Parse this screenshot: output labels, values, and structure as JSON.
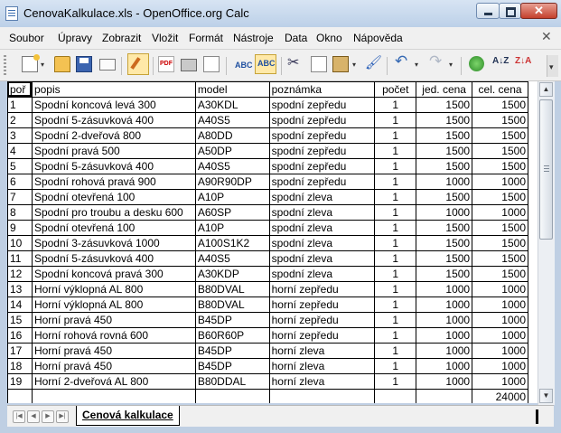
{
  "window": {
    "title": "CenovaKalkulace.xls - OpenOffice.org Calc"
  },
  "menu": [
    "Soubor",
    "Úpravy",
    "Zobrazit",
    "Vložit",
    "Formát",
    "Nástroje",
    "Data",
    "Okno",
    "Nápověda"
  ],
  "toolbar_icons": [
    "new-document-icon",
    "open-folder-icon",
    "save-disk-icon",
    "send-mail-icon",
    "edit-file-icon",
    "export-pdf-icon",
    "print-icon",
    "page-preview-icon",
    "spellcheck-icon",
    "autospellcheck-icon",
    "cut-scissors-icon",
    "copy-icon",
    "paste-icon",
    "format-paintbrush-icon",
    "undo-icon",
    "redo-icon",
    "navigator-icon",
    "sort-ascending-icon",
    "sort-descending-icon"
  ],
  "sheet": {
    "headers": [
      "poř",
      "popis",
      "model",
      "poznámka",
      "počet",
      "jed. cena",
      "cel. cena"
    ],
    "rows": [
      [
        "1",
        "Spodní koncová levá 300",
        "A30KDL",
        "spodní zepředu",
        "1",
        "1500",
        "1500"
      ],
      [
        "2",
        "Spodní 5-zásuvková 400",
        "A40S5",
        "spodní zepředu",
        "1",
        "1500",
        "1500"
      ],
      [
        "3",
        "Spodní 2-dveřová 800",
        "A80DD",
        "spodní zepředu",
        "1",
        "1500",
        "1500"
      ],
      [
        "4",
        "Spodní pravá 500",
        "A50DP",
        "spodní zepředu",
        "1",
        "1500",
        "1500"
      ],
      [
        "5",
        "Spodní 5-zásuvková 400",
        "A40S5",
        "spodní zepředu",
        "1",
        "1500",
        "1500"
      ],
      [
        "6",
        "Spodní rohová pravá 900",
        "A90R90DP",
        "spodní zepředu",
        "1",
        "1000",
        "1000"
      ],
      [
        "7",
        "Spodní otevřená 100",
        "A10P",
        "spodní zleva",
        "1",
        "1500",
        "1500"
      ],
      [
        "8",
        "Spodní pro troubu a desku 600",
        "A60SP",
        "spodní zleva",
        "1",
        "1000",
        "1000"
      ],
      [
        "9",
        "Spodní otevřená 100",
        "A10P",
        "spodní zleva",
        "1",
        "1500",
        "1500"
      ],
      [
        "10",
        "Spodní 3-zásuvková 1000",
        "A100S1K2",
        "spodní zleva",
        "1",
        "1500",
        "1500"
      ],
      [
        "11",
        "Spodní 5-zásuvková 400",
        "A40S5",
        "spodní zleva",
        "1",
        "1500",
        "1500"
      ],
      [
        "12",
        "Spodní koncová pravá 300",
        "A30KDP",
        "spodní zleva",
        "1",
        "1500",
        "1500"
      ],
      [
        "13",
        "Horní výklopná AL 800",
        "B80DVAL",
        "horní zepředu",
        "1",
        "1000",
        "1000"
      ],
      [
        "14",
        "Horní výklopná AL 800",
        "B80DVAL",
        "horní zepředu",
        "1",
        "1000",
        "1000"
      ],
      [
        "15",
        "Horní pravá 450",
        "B45DP",
        "horní zepředu",
        "1",
        "1000",
        "1000"
      ],
      [
        "16",
        "Horní rohová rovná 600",
        "B60R60P",
        "horní zepředu",
        "1",
        "1000",
        "1000"
      ],
      [
        "17",
        "Horní pravá 450",
        "B45DP",
        "horní zleva",
        "1",
        "1000",
        "1000"
      ],
      [
        "18",
        "Horní pravá 450",
        "B45DP",
        "horní zleva",
        "1",
        "1000",
        "1000"
      ],
      [
        "19",
        "Horní 2-dveřová AL 800",
        "B80DDAL",
        "horní zleva",
        "1",
        "1000",
        "1000"
      ]
    ],
    "total": "24000",
    "tab_name": "Cenová kalkulace"
  }
}
